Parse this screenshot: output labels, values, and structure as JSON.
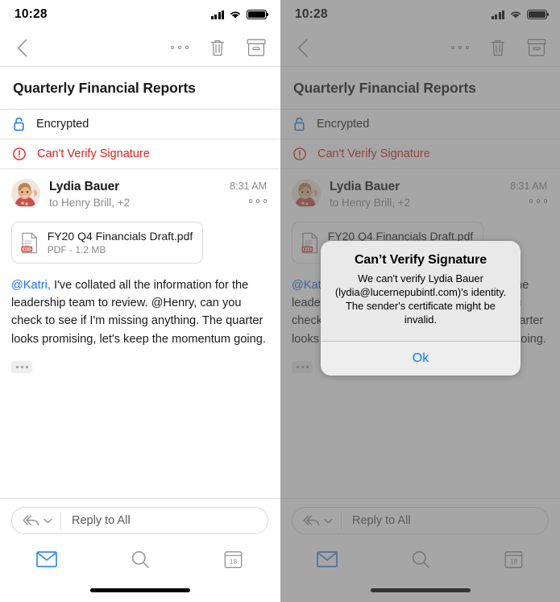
{
  "status": {
    "time": "10:28",
    "signal_icon": "cellular-signal-icon",
    "wifi_icon": "wifi-icon",
    "battery_icon": "battery-full-icon"
  },
  "toolbar": {
    "back_icon": "chevron-left-icon",
    "more_icon": "more-horizontal-icon",
    "delete_icon": "trash-icon",
    "archive_icon": "archive-box-icon"
  },
  "email": {
    "subject": "Quarterly Financial Reports",
    "banners": [
      {
        "id": "encrypted",
        "icon": "lock-icon",
        "label": "Encrypted",
        "color": "#1a73e8"
      },
      {
        "id": "signature",
        "icon": "exclamation-circle-icon",
        "label": "Can't Verify Signature",
        "color": "#e02020"
      }
    ],
    "sender_name": "Lydia Bauer",
    "recipients": "to Henry Brill, +2",
    "time": "8:31 AM",
    "sender_more_icon": "more-horizontal-icon",
    "avatar_icon": "avatar-photo",
    "attachment": {
      "icon": "pdf-file-icon",
      "name": "FY20 Q4 Financials Draft.pdf",
      "meta": "PDF - 1.2 MB"
    },
    "body": {
      "mention": "@Katri,",
      "text": " I've collated all the information for the leadership team to review. @Henry, can you check to see if I'm missing anything. The quarter looks promising, let's keep the momentum going.",
      "expand_icon": "ellipsis-expand-icon"
    }
  },
  "reply": {
    "icon": "reply-all-icon",
    "chevron_icon": "chevron-down-icon",
    "placeholder": "Reply to All"
  },
  "tabs": [
    {
      "id": "mail",
      "icon": "mail-envelope-icon",
      "active": true,
      "color": "#3a8dde"
    },
    {
      "id": "search",
      "icon": "search-icon",
      "active": false,
      "color": "#8e8e93"
    },
    {
      "id": "calendar",
      "icon": "calendar-icon",
      "active": false,
      "color": "#8e8e93",
      "day": "18"
    }
  ],
  "dialog": {
    "title": "Can’t Verify Signature",
    "message": "We can't verify Lydia Bauer (lydia@lucernepubintl.com)'s identity. The sender's certificate might be invalid.",
    "ok_label": "Ok",
    "ok_color": "#067dff"
  }
}
